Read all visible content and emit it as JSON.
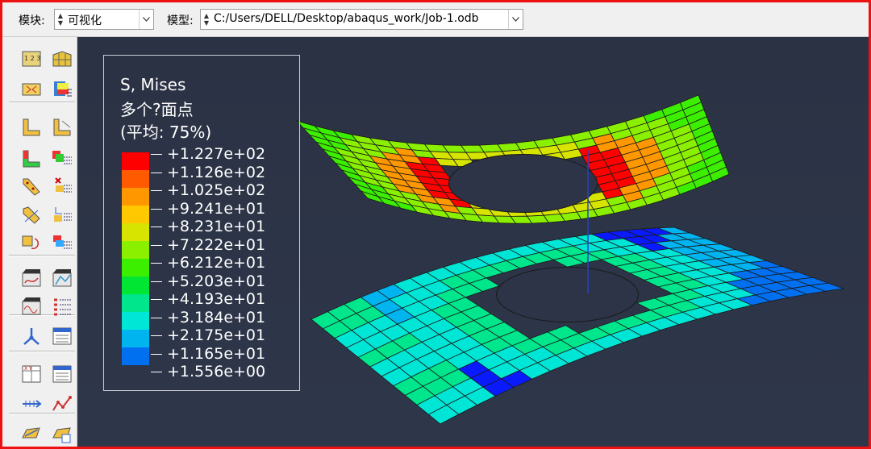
{
  "toolbar": {
    "module_label": "模块:",
    "module_value": "可视化",
    "model_label": "模型:",
    "model_value": "C:/Users/DELL/Desktop/abaqus_work/Job-1.odb"
  },
  "legend": {
    "title": "S, Mises",
    "subtitle": "多个?面点",
    "average": "(平均: 75%)",
    "values": [
      "+1.227e+02",
      "+1.126e+02",
      "+1.025e+02",
      "+9.241e+01",
      "+8.231e+01",
      "+7.222e+01",
      "+6.212e+01",
      "+5.203e+01",
      "+4.193e+01",
      "+3.184e+01",
      "+2.175e+01",
      "+1.165e+01",
      "+1.556e+00"
    ],
    "colors": [
      "#ff0000",
      "#ff5a00",
      "#ff9800",
      "#ffc800",
      "#d6e400",
      "#8af000",
      "#3cee00",
      "#00e632",
      "#00e68c",
      "#00e6d6",
      "#00b4f0",
      "#0070f0",
      "#0a1aff"
    ]
  },
  "toolbox": {
    "icons": [
      "plot-undeformed-icon",
      "plot-deformed-icon",
      "plot-contours-icon",
      "plot-symbols-icon",
      "plot-material-orientation-icon",
      "common-options-icon",
      "allow-multiple-plot-states-icon",
      "superimpose-options-icon",
      "contour-options-icon",
      "contour-options-stack-icon",
      "symbol-options-icon",
      "symbol-options-stack-icon",
      "orientation-options-icon",
      "orientation-options-stack-icon",
      "animate-scale-factor-icon",
      "animate-time-history-icon",
      "animate-harmonic-icon",
      "animation-options-icon",
      "create-display-group-icon",
      "display-group-manager-icon",
      "xy-data-create-icon",
      "xy-data-manager-icon",
      "create-path-icon",
      "xy-plot-icon",
      "view-cut-icon",
      "view-cut-manager-icon"
    ]
  },
  "colors": {
    "frame": "#ee1111",
    "viewport_bg": "#2c3347"
  }
}
